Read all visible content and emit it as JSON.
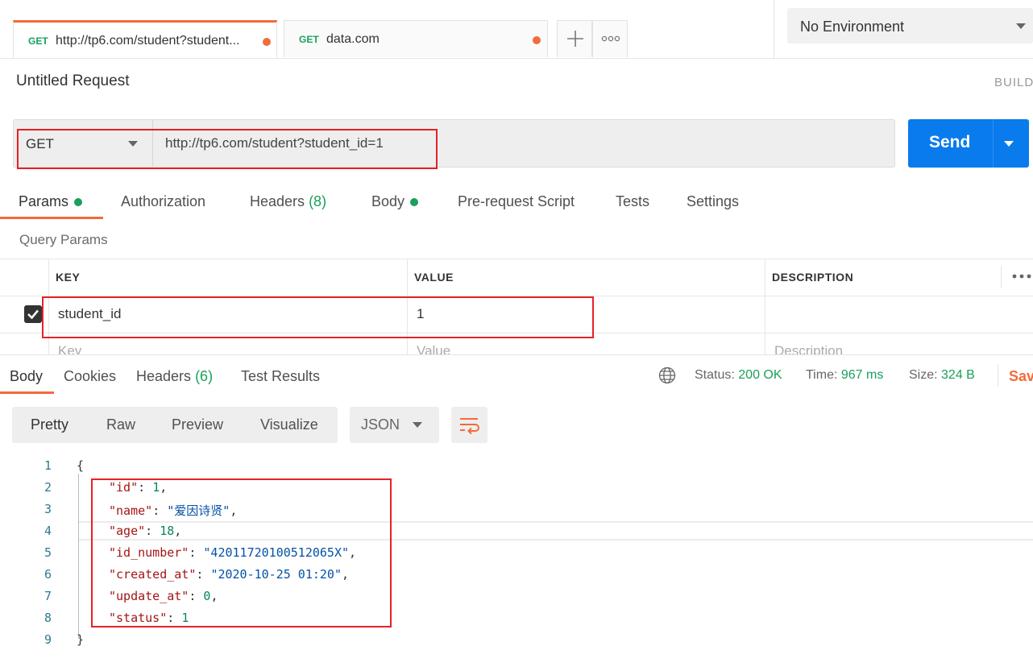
{
  "tabs": [
    {
      "method": "GET",
      "label": "http://tp6.com/student?student...",
      "unsaved": true
    },
    {
      "method": "GET",
      "label": "data.com",
      "unsaved": true
    }
  ],
  "tab_actions": {
    "new_tab": "+",
    "more": "ooo"
  },
  "environment": {
    "selected": "No Environment"
  },
  "request": {
    "title": "Untitled Request",
    "build_label": "BUILD",
    "method": "GET",
    "url": "http://tp6.com/student?student_id=1",
    "send_label": "Send"
  },
  "request_tabs": [
    {
      "label": "Params",
      "indicator": true
    },
    {
      "label": "Authorization"
    },
    {
      "label": "Headers",
      "count": "(8)"
    },
    {
      "label": "Body",
      "indicator": true
    },
    {
      "label": "Pre-request Script"
    },
    {
      "label": "Tests"
    },
    {
      "label": "Settings"
    }
  ],
  "query_params": {
    "heading": "Query Params",
    "columns": [
      "KEY",
      "VALUE",
      "DESCRIPTION"
    ],
    "rows": [
      {
        "checked": true,
        "key": "student_id",
        "value": "1",
        "description": ""
      }
    ],
    "placeholders": {
      "key": "Key",
      "value": "Value",
      "description": "Description"
    }
  },
  "response_tabs": [
    {
      "label": "Body"
    },
    {
      "label": "Cookies"
    },
    {
      "label": "Headers",
      "count": "(6)"
    },
    {
      "label": "Test Results"
    }
  ],
  "response_status": {
    "status_label": "Status:",
    "status_value": "200 OK",
    "time_label": "Time:",
    "time_value": "967 ms",
    "size_label": "Size:",
    "size_value": "324 B",
    "save_label": "Sav"
  },
  "view_modes": [
    "Pretty",
    "Raw",
    "Preview",
    "Visualize"
  ],
  "format": {
    "selected": "JSON"
  },
  "response_body": {
    "line_numbers": [
      "1",
      "2",
      "3",
      "4",
      "5",
      "6",
      "7",
      "8",
      "9"
    ],
    "open_brace": "{",
    "close_brace": "}",
    "fields": [
      {
        "key": "\"id\"",
        "value": "1",
        "type": "number",
        "comma": ","
      },
      {
        "key": "\"name\"",
        "value": "\"爱因诗贤\"",
        "type": "string",
        "comma": ","
      },
      {
        "key": "\"age\"",
        "value": "18",
        "type": "number",
        "comma": ","
      },
      {
        "key": "\"id_number\"",
        "value": "\"42011720100512065X\"",
        "type": "string",
        "comma": ","
      },
      {
        "key": "\"created_at\"",
        "value": "\"2020-10-25 01:20\"",
        "type": "string",
        "comma": ","
      },
      {
        "key": "\"update_at\"",
        "value": "0",
        "type": "number",
        "comma": ","
      },
      {
        "key": "\"status\"",
        "value": "1",
        "type": "number",
        "comma": ""
      }
    ]
  },
  "colors": {
    "accent": "#f26b3a",
    "send": "#097bed",
    "success": "#18a05c",
    "highlight_box": "#e62128"
  }
}
